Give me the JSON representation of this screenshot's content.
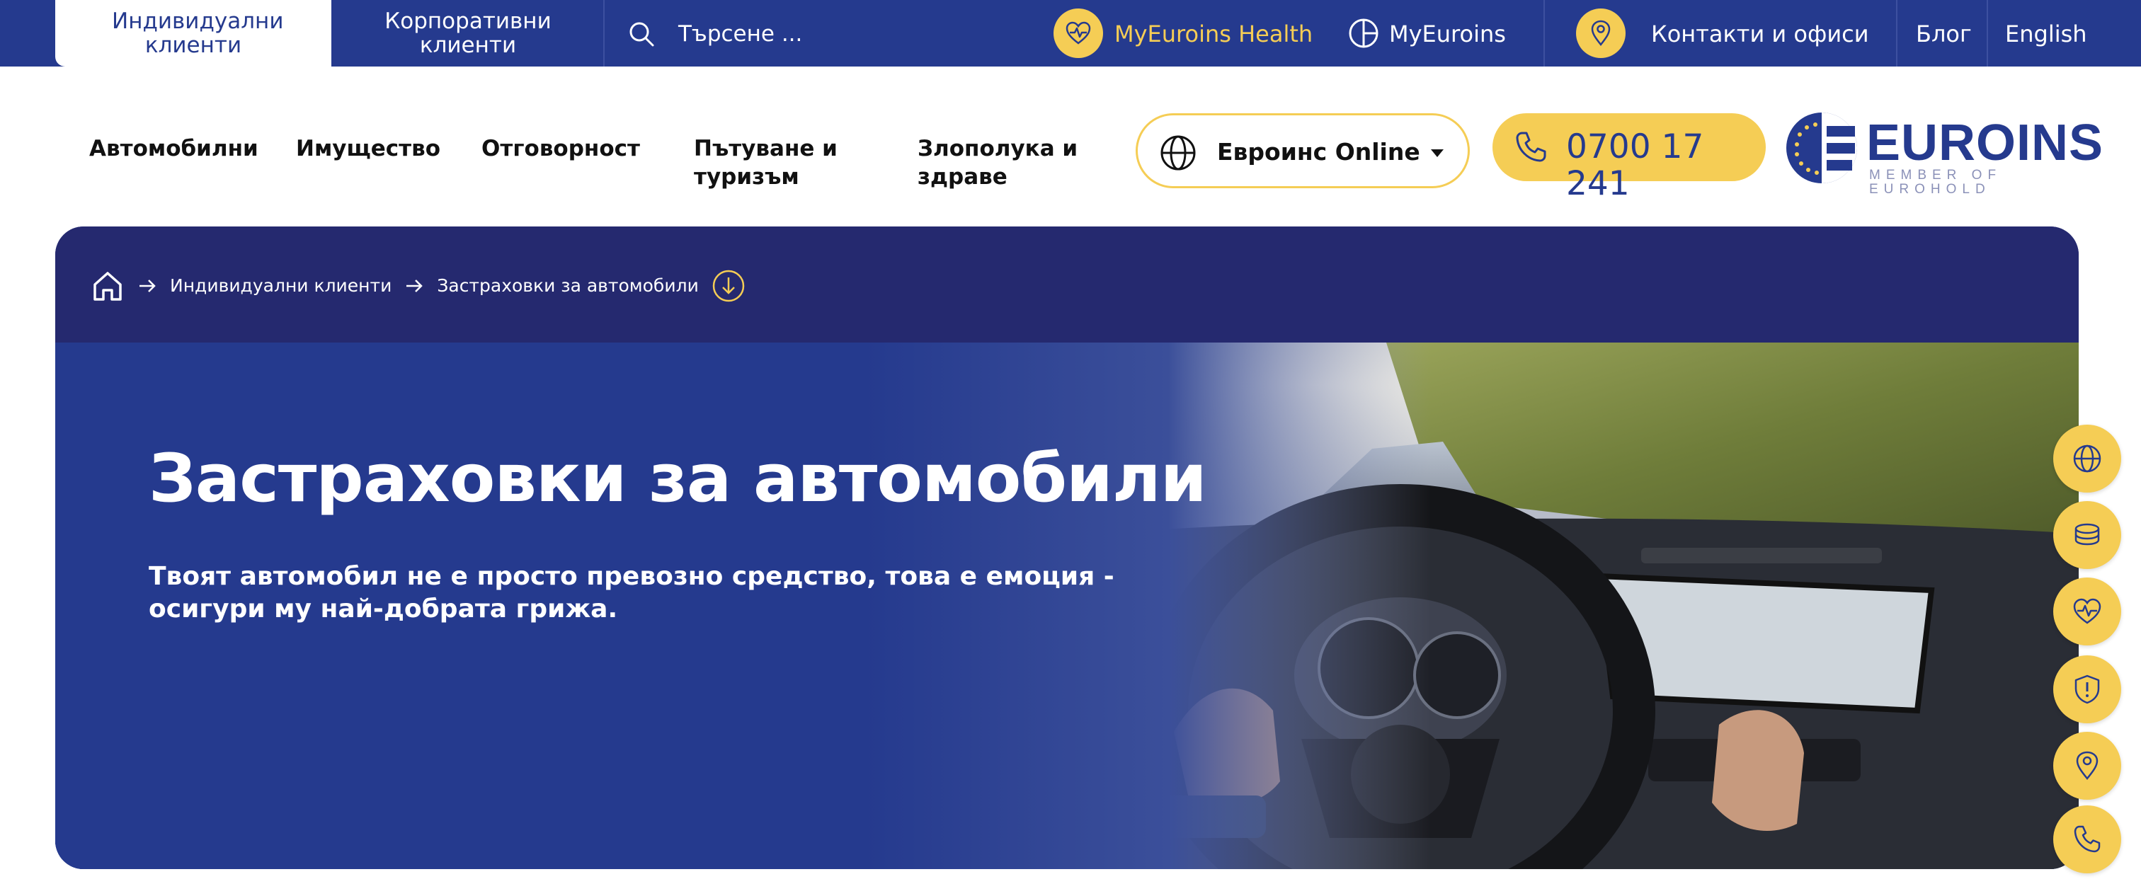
{
  "topbar": {
    "tabs": [
      {
        "label": "Индивидуални клиенти"
      },
      {
        "label": "Корпоративни клиенти"
      }
    ],
    "search_placeholder": "Търсене ...",
    "health_link": "MyEuroins Health",
    "myeuroins_link": "MyEuroins",
    "contacts_link": "Контакти и офиси",
    "blog_link": "Блог",
    "language_link": "English"
  },
  "nav": {
    "items": [
      {
        "label": "Автомобилни"
      },
      {
        "label": "Имущество"
      },
      {
        "label": "Отговорност"
      },
      {
        "label": "Пътуване и туризъм"
      },
      {
        "label": "Злополука и здраве"
      }
    ],
    "online_button": "Евроинс Online",
    "phone": "0700 17 241"
  },
  "logo": {
    "name": "EUROINS",
    "tagline": "MEMBER OF EUROHOLD"
  },
  "breadcrumb": {
    "items": [
      {
        "label": "Индивидуални клиенти"
      },
      {
        "label": "Застраховки за автомобили"
      }
    ]
  },
  "hero": {
    "title": "Застраховки за автомобили",
    "subtitle": "Твоят автомобил не е просто превозно средство, това е емоция - осигури му най-добрата грижа."
  },
  "colors": {
    "brand_blue": "#253a8e",
    "accent_yellow": "#f5cd55",
    "hero_navy": "#25296f"
  },
  "floating_buttons": [
    {
      "icon": "globe-icon"
    },
    {
      "icon": "coins-icon"
    },
    {
      "icon": "heart-pulse-icon"
    },
    {
      "icon": "shield-alert-icon"
    },
    {
      "icon": "location-pin-icon"
    },
    {
      "icon": "phone-icon"
    }
  ]
}
